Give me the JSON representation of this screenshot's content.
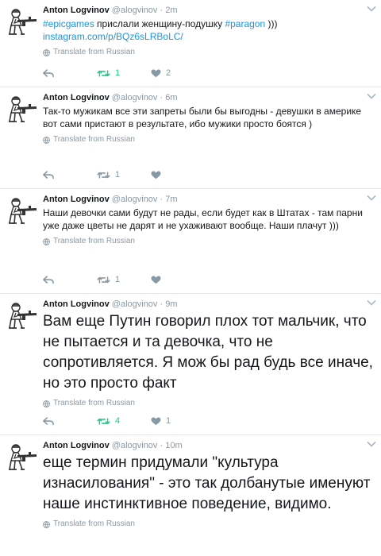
{
  "tweets": [
    {
      "name": "Anton Logvinov",
      "handle": "@alogvinov",
      "dot": "·",
      "time": "2m",
      "hashtag1": "#epicgames",
      "mid_text": " прислали женщину-подушку ",
      "hashtag2": "#paragon",
      "end_text": " )))",
      "link": "instagram.com/p/BQz6sLRBoLC/",
      "translate": "Translate from Russian",
      "retweets": "1",
      "likes": "2"
    },
    {
      "name": "Anton Logvinov",
      "handle": "@alogvinov",
      "dot": "·",
      "time": "6m",
      "text": "Так-то мужикам все эти запреты были бы выгодны - девушки в америке вот сами пристают в результате, ибо мужики просто боятся )",
      "translate": "Translate from Russian",
      "retweets": "1",
      "likes": ""
    },
    {
      "name": "Anton Logvinov",
      "handle": "@alogvinov",
      "dot": "·",
      "time": "7m",
      "text": "Наши девочки сами будут не рады, если будет как в Штатах - там парни уже даже цветы не дарят и не ухаживают вообще. Наши плачут )))",
      "translate": "Translate from Russian",
      "retweets": "1",
      "likes": ""
    },
    {
      "name": "Anton Logvinov",
      "handle": "@alogvinov",
      "dot": "·",
      "time": "9m",
      "text": "Вам еще Путин говорил плох тот мальчик, что не пытается и та девочка, что не сопротивляется. Я мож бы рад будь все иначе, но это просто факт",
      "translate": "Translate from Russian",
      "retweets": "4",
      "likes": "1"
    },
    {
      "name": "Anton Logvinov",
      "handle": "@alogvinov",
      "dot": "·",
      "time": "10m",
      "text": "еще термин придумали \"культура изнасилования\" - это так долбанутые именуют наше инстинктивное поведение, видимо.",
      "translate": "Translate from Russian"
    }
  ],
  "colors": {
    "link": "#1b95e0",
    "muted": "#8899a6",
    "retweet_active": "#19cf86",
    "border": "#e1e8ed"
  },
  "icons": {
    "avatar": "soldier-with-rifle-avatar",
    "reply": "reply-arrow-icon",
    "retweet": "retweet-icon",
    "like": "heart-icon",
    "chevron": "chevron-down-icon",
    "globe": "globe-icon"
  }
}
